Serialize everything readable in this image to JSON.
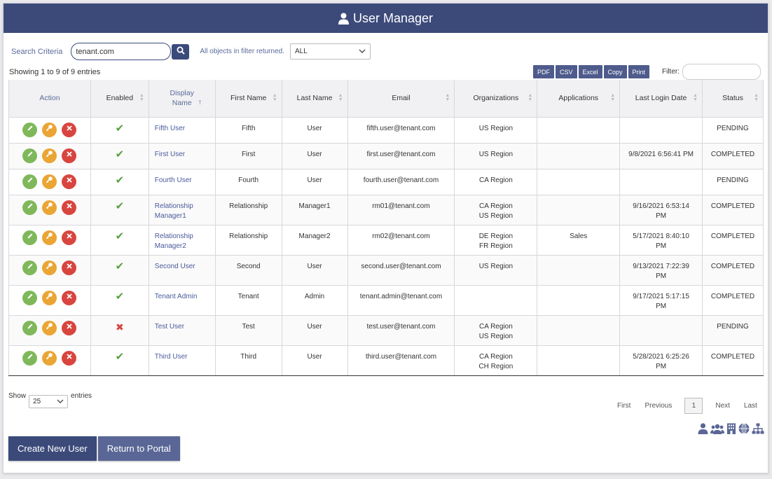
{
  "header": {
    "title": "User Manager"
  },
  "search": {
    "label": "Search Criteria",
    "value": "tenant.com",
    "filter_note": "All objects in filter returned.",
    "scope_value": "ALL"
  },
  "summary": {
    "showing": "Showing 1 to 9 of 9 entries"
  },
  "exports": [
    "PDF",
    "CSV",
    "Excel",
    "Copy",
    "Print"
  ],
  "filter": {
    "label": "Filter:"
  },
  "columns": [
    "Action",
    "Enabled",
    "Display Name",
    "First Name",
    "Last Name",
    "Email",
    "Organizations",
    "Applications",
    "Last Login Date",
    "Status"
  ],
  "rows": [
    {
      "enabled": true,
      "display1": "Fifth User",
      "display2": "",
      "first": "Fifth",
      "last": "User",
      "email": "fifth.user@tenant.com",
      "org1": "US Region",
      "org2": "",
      "app": "",
      "login1": "",
      "login2": "",
      "status": "PENDING"
    },
    {
      "enabled": true,
      "display1": "First User",
      "display2": "",
      "first": "First",
      "last": "User",
      "email": "first.user@tenant.com",
      "org1": "US Region",
      "org2": "",
      "app": "",
      "login1": "9/8/2021 6:56:41 PM",
      "login2": "",
      "status": "COMPLETED"
    },
    {
      "enabled": true,
      "display1": "Fourth User",
      "display2": "",
      "first": "Fourth",
      "last": "User",
      "email": "fourth.user@tenant.com",
      "org1": "CA Region",
      "org2": "",
      "app": "",
      "login1": "",
      "login2": "",
      "status": "PENDING"
    },
    {
      "enabled": true,
      "display1": "Relationship",
      "display2": "Manager1",
      "first": "Relationship",
      "last": "Manager1",
      "email": "rm01@tenant.com",
      "org1": "CA Region",
      "org2": "US Region",
      "app": "",
      "login1": "9/16/2021 6:53:14",
      "login2": "PM",
      "status": "COMPLETED"
    },
    {
      "enabled": true,
      "display1": "Relationship",
      "display2": "Manager2",
      "first": "Relationship",
      "last": "Manager2",
      "email": "rm02@tenant.com",
      "org1": "DE Region",
      "org2": "FR Region",
      "app": "Sales",
      "login1": "5/17/2021 8:40:10",
      "login2": "PM",
      "status": "COMPLETED"
    },
    {
      "enabled": true,
      "display1": "Second User",
      "display2": "",
      "first": "Second",
      "last": "User",
      "email": "second.user@tenant.com",
      "org1": "US Region",
      "org2": "",
      "app": "",
      "login1": "9/13/2021 7:22:39",
      "login2": "PM",
      "status": "COMPLETED"
    },
    {
      "enabled": true,
      "display1": "Tenant Admin",
      "display2": "",
      "first": "Tenant",
      "last": "Admin",
      "email": "tenant.admin@tenant.com",
      "org1": "",
      "org2": "",
      "app": "",
      "login1": "9/17/2021 5:17:15",
      "login2": "PM",
      "status": "COMPLETED"
    },
    {
      "enabled": false,
      "display1": "Test User",
      "display2": "",
      "first": "Test",
      "last": "User",
      "email": "test.user@tenant.com",
      "org1": "CA Region",
      "org2": "US Region",
      "app": "",
      "login1": "",
      "login2": "",
      "status": "PENDING"
    },
    {
      "enabled": true,
      "display1": "Third User",
      "display2": "",
      "first": "Third",
      "last": "User",
      "email": "third.user@tenant.com",
      "org1": "CA Region",
      "org2": "CH Region",
      "app": "",
      "login1": "5/28/2021 6:25:26",
      "login2": "PM",
      "status": "COMPLETED"
    }
  ],
  "length": {
    "show": "Show",
    "value": "25",
    "entries": "entries"
  },
  "pager": {
    "first": "First",
    "previous": "Previous",
    "current": "1",
    "next": "Next",
    "last": "Last"
  },
  "footer_icons": [
    "user-icon",
    "users-icon",
    "building-icon",
    "globe-icon",
    "sitemap-icon"
  ],
  "buttons": {
    "create": "Create New User",
    "return": "Return to Portal"
  },
  "colors": {
    "primary": "#3c4a7a",
    "link": "#4a5a9a",
    "ok": "#58a042",
    "danger": "#d8453f",
    "warn": "#eba534",
    "edit": "#7fb85a"
  }
}
